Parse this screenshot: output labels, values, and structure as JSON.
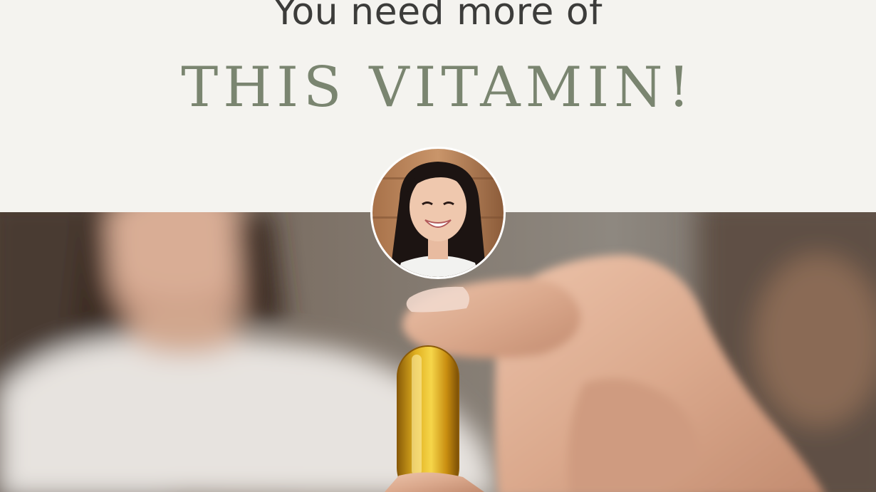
{
  "headline": "You need more of",
  "subheadline": "THIS VITAMIN!",
  "colors": {
    "header_background": "#f4f3ef",
    "headline_text": "#3c3c3a",
    "subheadline_text": "#7a8570",
    "capsule": "#d9a818"
  },
  "images": {
    "avatar": "smiling woman with long dark hair (circular profile photo)",
    "main_photo": "blurred person holding a yellow softgel vitamin capsule between fingers"
  }
}
